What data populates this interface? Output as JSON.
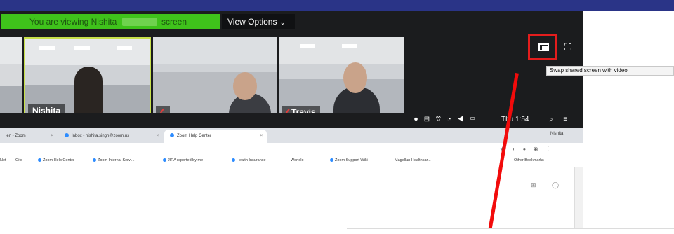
{
  "banner": {
    "viewing_prefix": "You are viewing Nishita",
    "viewing_suffix": "screen"
  },
  "view_options": {
    "label": "View Options",
    "chevron": "⌄"
  },
  "participants": [
    {
      "name": "Nishita"
    },
    {
      "name": ""
    },
    {
      "name": "Travis"
    }
  ],
  "toolbar": {
    "swap_icon": "swap-screen-icon",
    "fullscreen_icon": "fullscreen-icon",
    "fullscreen_glyph": "⛶"
  },
  "tooltip": {
    "text": "Swap shared screen with video"
  },
  "menubar": {
    "icons": "⏺ ⊟ ♡ ◔ ◀ ▭",
    "clock": "Thu 1:54"
  },
  "browser": {
    "tabs": [
      {
        "label": "ien - Zoom"
      },
      {
        "label": "Inbox - nishita.singh@zoom.us"
      },
      {
        "label": "Zoom Help Center"
      }
    ],
    "profile": "Nishita",
    "url_icons": "★ ◐ ● ◉ ⋮",
    "bookmarks": [
      {
        "label": "Net"
      },
      {
        "label": "Gifs"
      },
      {
        "label": "Zoom Help Center"
      },
      {
        "label": "Zoom Internal Servi..."
      },
      {
        "label": "JIRA reported by me"
      },
      {
        "label": "Health Insurance"
      },
      {
        "label": "Wonolo"
      },
      {
        "label": "Zoom Support Wiki"
      },
      {
        "label": "Magellan Healthcar..."
      },
      {
        "label": "Other Bookmarks"
      }
    ]
  },
  "colors": {
    "banner_green": "#3fc21b",
    "highlight_red": "#e41d1d",
    "zoom_dark": "#1b1c1e",
    "top_band": "#2a3487"
  }
}
